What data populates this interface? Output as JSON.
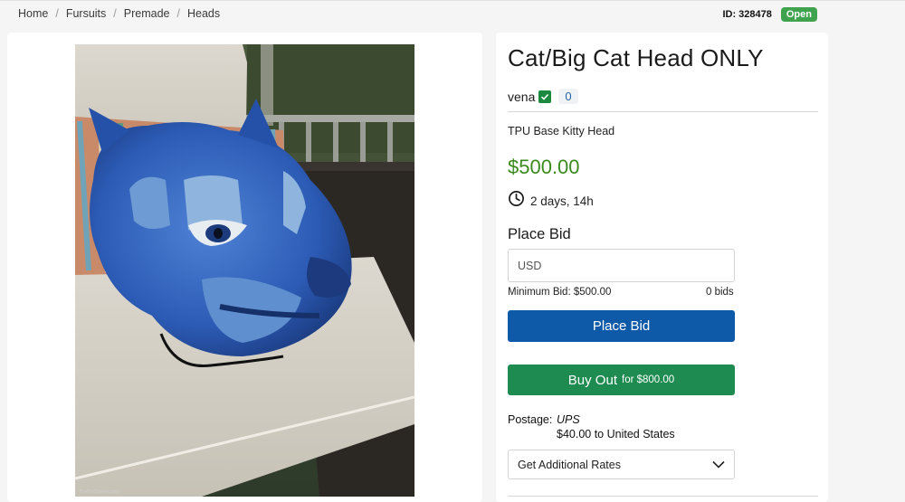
{
  "breadcrumb": [
    "Home",
    "Fursuits",
    "Premade",
    "Heads"
  ],
  "listing": {
    "id_label": "ID: 328478",
    "status": "Open",
    "title": "Cat/Big Cat Head ONLY",
    "seller": "vena",
    "feedback": "0",
    "subtitle": "TPU Base Kitty Head",
    "price": "$500.00",
    "time_left": "2 days, 14h"
  },
  "bid": {
    "heading": "Place Bid",
    "placeholder": "USD",
    "min_bid": "Minimum Bid: $500.00",
    "bid_count": "0 bids",
    "button": "Place Bid"
  },
  "buyout": {
    "label": "Buy Out",
    "price_text": "for $800.00"
  },
  "postage": {
    "label": "Postage:",
    "method": "UPS",
    "cost": "$40.00 to United States",
    "rates_label": "Get Additional Rates"
  },
  "colors": {
    "price": "#3b8a1f",
    "bid_button": "#0f5aa8",
    "buyout_button": "#1e8c50",
    "open_badge": "#3fa34d"
  },
  "icons": [
    "check-icon",
    "clock-icon",
    "chevron-down-icon"
  ]
}
